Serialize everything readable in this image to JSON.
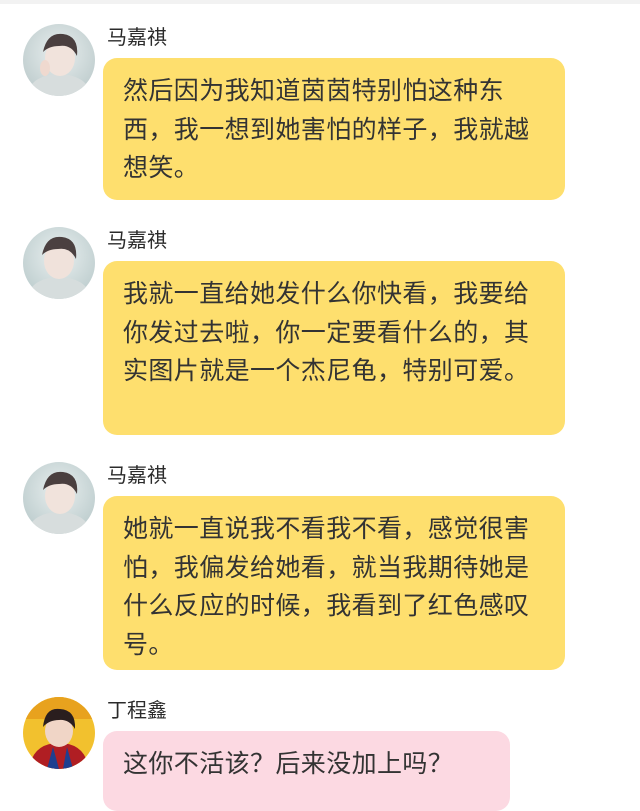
{
  "colors": {
    "bubble_yellow": "#fedf6e",
    "bubble_pink": "#fcd9e2",
    "text": "#333333"
  },
  "messages": [
    {
      "sender": "马嘉祺",
      "avatar": "avatar-photo-boy-pale",
      "text": "然后因为我知道茵茵特别怕这种东西，我一想到她害怕的样子，我就越想笑。"
    },
    {
      "sender": "马嘉祺",
      "avatar": "avatar-photo-boy-pale",
      "text": "我就一直给她发什么你快看，我要给你发过去啦，你一定要看什么的，其实图片就是一个杰尼龟，特别可爱。"
    },
    {
      "sender": "马嘉祺",
      "avatar": "avatar-photo-boy-pale",
      "text": "她就一直说我不看我不看，感觉很害怕，我偏发给她看，就当我期待她是什么反应的时候，我看到了红色感叹号。"
    },
    {
      "sender": "丁程鑫",
      "avatar": "avatar-photo-boy-red",
      "text": "这你不活该？后来没加上吗？"
    }
  ]
}
